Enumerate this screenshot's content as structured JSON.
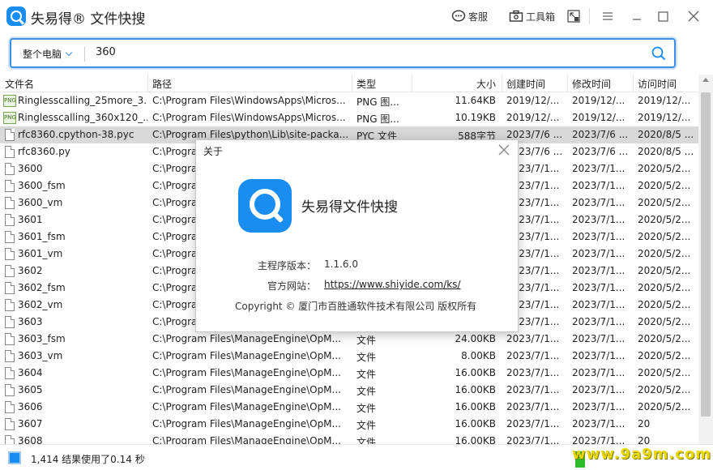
{
  "app": {
    "title": "失易得® 文件快搜"
  },
  "toolbar": {
    "service_label": "客服",
    "tools_label": "工具箱"
  },
  "search": {
    "scope": "整个电脑",
    "query": "360"
  },
  "columns": {
    "name": "文件名",
    "path": "路径",
    "type": "类型",
    "size": "大小",
    "ctime": "创建时间",
    "mtime": "修改时间",
    "atime": "访问时间"
  },
  "rows": [
    {
      "icon": "png",
      "name": "Ringlesscalling_25more_3...",
      "path": "C:\\Program Files\\WindowsApps\\Micros...",
      "type": "PNG 图...",
      "size": "11.64KB",
      "ctime": "2019/12/...",
      "mtime": "2019/12/...",
      "atime": "2019/12/..."
    },
    {
      "icon": "png",
      "name": "Ringlesscalling_360x120_...",
      "path": "C:\\Program Files\\WindowsApps\\Micros...",
      "type": "PNG 图...",
      "size": "10.19KB",
      "ctime": "2019/12/...",
      "mtime": "2019/12/...",
      "atime": "2019/12/..."
    },
    {
      "icon": "file",
      "name": "rfc8360.cpython-38.pyc",
      "path": "C:\\Program Files\\python\\Lib\\site-packa...",
      "type": "PYC 文件",
      "size": "588字节",
      "ctime": "2023/7/6 ...",
      "mtime": "2023/7/6 ...",
      "atime": "2020/8/5 ...",
      "selected": true
    },
    {
      "icon": "file",
      "name": "rfc8360.py",
      "path": "C:\\Progra",
      "type": "",
      "size": "",
      "ctime": "2023/7/6 ...",
      "mtime": "2023/7/6 ...",
      "atime": "2020/8/5 ..."
    },
    {
      "icon": "file",
      "name": "3600",
      "path": "C:\\Progra",
      "type": "",
      "size": "",
      "ctime": "2023/7/1...",
      "mtime": "2023/7/1...",
      "atime": "2020/5/2..."
    },
    {
      "icon": "file",
      "name": "3600_fsm",
      "path": "C:\\Progra",
      "type": "",
      "size": "",
      "ctime": "2023/7/1...",
      "mtime": "2023/7/1...",
      "atime": "2020/5/2..."
    },
    {
      "icon": "file",
      "name": "3600_vm",
      "path": "C:\\Progra",
      "type": "",
      "size": "",
      "ctime": "2023/7/1...",
      "mtime": "2023/7/1...",
      "atime": "2020/5/2..."
    },
    {
      "icon": "file",
      "name": "3601",
      "path": "C:\\Progra",
      "type": "",
      "size": "",
      "ctime": "2023/7/1...",
      "mtime": "2023/7/1...",
      "atime": "2020/5/2..."
    },
    {
      "icon": "file",
      "name": "3601_fsm",
      "path": "C:\\Progra",
      "type": "",
      "size": "",
      "ctime": "2023/7/1...",
      "mtime": "2023/7/1...",
      "atime": "2020/5/2..."
    },
    {
      "icon": "file",
      "name": "3601_vm",
      "path": "C:\\Progra",
      "type": "",
      "size": "",
      "ctime": "2023/7/1...",
      "mtime": "2023/7/1...",
      "atime": "2020/5/2..."
    },
    {
      "icon": "file",
      "name": "3602",
      "path": "C:\\Progra",
      "type": "",
      "size": "",
      "ctime": "2023/7/1...",
      "mtime": "2023/7/1...",
      "atime": "2020/5/2..."
    },
    {
      "icon": "file",
      "name": "3602_fsm",
      "path": "C:\\Progra",
      "type": "",
      "size": "",
      "ctime": "2023/7/1...",
      "mtime": "2023/7/1...",
      "atime": "2020/5/2..."
    },
    {
      "icon": "file",
      "name": "3602_vm",
      "path": "C:\\Progra",
      "type": "",
      "size": "",
      "ctime": "2023/7/1...",
      "mtime": "2023/7/1...",
      "atime": "2020/5/2..."
    },
    {
      "icon": "file",
      "name": "3603",
      "path": "C:\\Progra",
      "type": "",
      "size": "",
      "ctime": "2023/7/1...",
      "mtime": "2023/7/1...",
      "atime": "2020/5/2..."
    },
    {
      "icon": "file",
      "name": "3603_fsm",
      "path": "C:\\Program Files\\ManageEngine\\OpM...",
      "type": "文件",
      "size": "24.00KB",
      "ctime": "2023/7/1...",
      "mtime": "2023/7/1...",
      "atime": "2020/5/2..."
    },
    {
      "icon": "file",
      "name": "3603_vm",
      "path": "C:\\Program Files\\ManageEngine\\OpM...",
      "type": "文件",
      "size": "8.00KB",
      "ctime": "2023/7/1...",
      "mtime": "2023/7/1...",
      "atime": "2020/5/2..."
    },
    {
      "icon": "file",
      "name": "3604",
      "path": "C:\\Program Files\\ManageEngine\\OpM...",
      "type": "文件",
      "size": "16.00KB",
      "ctime": "2023/7/1...",
      "mtime": "2023/7/1...",
      "atime": "2020/5/2..."
    },
    {
      "icon": "file",
      "name": "3605",
      "path": "C:\\Program Files\\ManageEngine\\OpM...",
      "type": "文件",
      "size": "16.00KB",
      "ctime": "2023/7/1...",
      "mtime": "2023/7/1...",
      "atime": "2020/5/2..."
    },
    {
      "icon": "file",
      "name": "3606",
      "path": "C:\\Program Files\\ManageEngine\\OpM...",
      "type": "文件",
      "size": "16.00KB",
      "ctime": "2023/7/1...",
      "mtime": "2023/7/1...",
      "atime": "2020/5/2..."
    },
    {
      "icon": "file",
      "name": "3607",
      "path": "C:\\Program Files\\ManageEngine\\OpM...",
      "type": "文件",
      "size": "16.00KB",
      "ctime": "2023/7/1...",
      "mtime": "2023/7/1...",
      "atime": "20"
    },
    {
      "icon": "file",
      "name": "3608",
      "path": "C:\\Program Files\\ManageEngine\\OpM...",
      "type": "文件",
      "size": "16.00KB",
      "ctime": "2023/7/1...",
      "mtime": "2023/7/1...",
      "atime": "20"
    }
  ],
  "status": {
    "text": "1,414 结果使用了0.14 秒",
    "watermark": "www.9a9m.com"
  },
  "about": {
    "title": "关于",
    "app_name": "失易得文件快搜",
    "version_label": "主程序版本：",
    "version": "1.1.6.0",
    "website_label": "官方网站：",
    "website": "https://www.shiyide.com/ks/",
    "copyright": "Copyright © 厦门市百胜通软件技术有限公司 版权所有"
  },
  "colors": {
    "accent": "#1a8df0",
    "search_border": "#3d8fe6",
    "selected_row": "#d9d9d9"
  }
}
